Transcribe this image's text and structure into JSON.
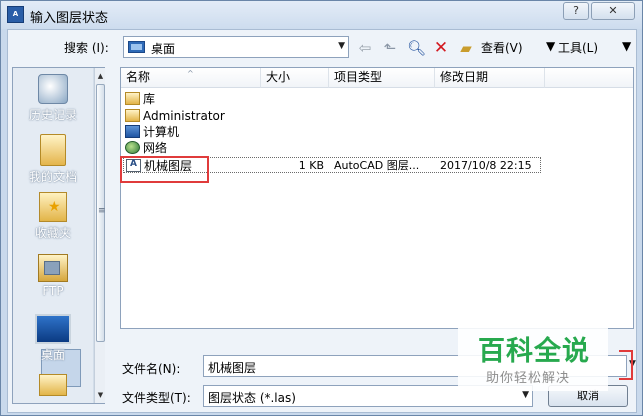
{
  "window": {
    "title": "输入图层状态",
    "app_icon_text": "A",
    "help_glyph": "?",
    "close_glyph": "✕"
  },
  "toolbar": {
    "search_label": "搜索 (I):",
    "path_value": "桌面",
    "view_label": "查看(V)",
    "tools_label": "工具(L)",
    "dropdown_glyph": "▼",
    "icons": [
      "back-icon",
      "up-folder-icon",
      "search-web-icon",
      "delete-icon",
      "create-folder-icon"
    ]
  },
  "places": {
    "items": [
      {
        "label": "历史记录",
        "icon": "history-icon"
      },
      {
        "label": "我的文档",
        "icon": "documents-icon"
      },
      {
        "label": "收藏夹",
        "icon": "favorites-icon"
      },
      {
        "label": "FTP",
        "icon": "ftp-icon"
      },
      {
        "label": "桌面",
        "icon": "desktop-icon",
        "selected": true
      }
    ]
  },
  "filelist": {
    "columns": [
      "名称",
      "大小",
      "项目类型",
      "修改日期"
    ],
    "rows": [
      {
        "name": "库",
        "size": "",
        "type": "",
        "date": "",
        "icon": "library-icon"
      },
      {
        "name": "Administrator",
        "size": "",
        "type": "",
        "date": "",
        "icon": "user-folder-icon"
      },
      {
        "name": "计算机",
        "size": "",
        "type": "",
        "date": "",
        "icon": "computer-icon"
      },
      {
        "name": "网络",
        "size": "",
        "type": "",
        "date": "",
        "icon": "network-icon"
      },
      {
        "name": "机械图层",
        "size": "1 KB",
        "type": "AutoCAD 图层...",
        "date": "2017/10/8 22:15",
        "icon": "las-file-icon",
        "selected": true
      }
    ]
  },
  "footer": {
    "filename_label": "文件名(N):",
    "filename_value": "机械图层",
    "filetype_label": "文件类型(T):",
    "filetype_value": "图层状态 (*.las)",
    "cancel_label": "取消"
  },
  "watermark": {
    "main": "百科全说",
    "sub": "助你轻松解决"
  },
  "colors": {
    "highlight_box": "#e03b3b",
    "watermark_green": "#27a94e"
  }
}
